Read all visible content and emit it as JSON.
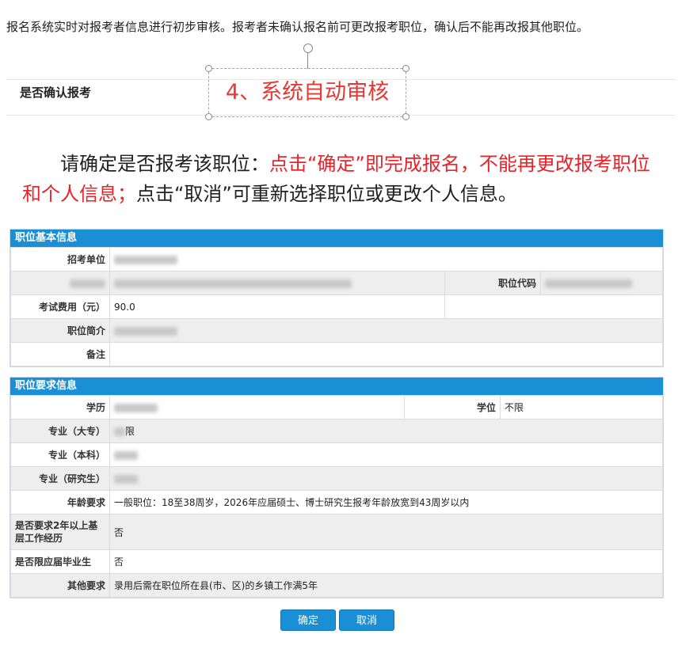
{
  "intro_text": "报名系统实时对报考者信息进行初步审核。报考者未确认报名前可更改报考职位，确认后不能再改报其他职位。",
  "confirm_heading": "是否确认报考",
  "overlay_label": "4、系统自动审核",
  "notice": {
    "part1": "请确定是否报考该职位：",
    "part2": "点击“确定”即完成报名，不能再更改报考职位和个人信息；",
    "part3": "点击“取消”可重新选择职位或更改个人信息。"
  },
  "colors": {
    "accent": "#1a8fd6",
    "highlight_red": "#e8232a"
  },
  "position_info": {
    "title": "职位基本信息",
    "employer_label": "招考单位",
    "position_code_label": "职位代码",
    "exam_fee_label": "考试费用（元）",
    "exam_fee_value": "90.0",
    "intro_label": "职位简介",
    "remarks_label": "备注"
  },
  "requirements": {
    "title": "职位要求信息",
    "education_label": "学历",
    "degree_label": "学位",
    "degree_value": "不限",
    "major_junior_label": "专业（大专）",
    "major_junior_value": "限",
    "major_bachelor_label": "专业（本科）",
    "major_master_label": "专业（研究生）",
    "age_label": "年龄要求",
    "age_value": "一般职位：18至38周岁，2026年应届硕士、博士研究生报考年龄放宽到43周岁以内",
    "grassroots_label": "是否要求2年以上基层工作经历",
    "grassroots_value": "否",
    "fresh_grad_label": "是否限应届毕业生",
    "fresh_grad_value": "否",
    "other_label": "其他要求",
    "other_value": "录用后需在职位所在县(市、区)的乡镇工作满5年"
  },
  "buttons": {
    "confirm": "确定",
    "cancel": "取消"
  }
}
